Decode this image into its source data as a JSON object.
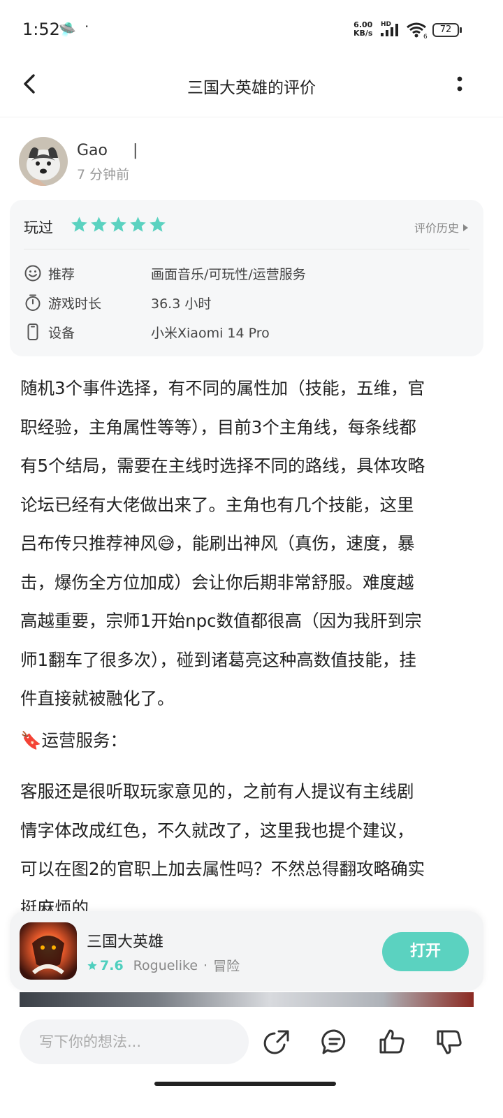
{
  "status_bar": {
    "time": "1:52",
    "net_speed_value": "6.00",
    "net_speed_unit": "KB/s",
    "hd_label": "HD",
    "wifi_label": "6",
    "battery": "72"
  },
  "header": {
    "title": "三国大英雄的评价"
  },
  "author": {
    "name": "Gao",
    "time": "7 分钟前"
  },
  "rating": {
    "played_label": "玩过",
    "stars": 5,
    "history_label": "评价历史",
    "star_color": "#5bd2c0",
    "rows": [
      {
        "label": "推荐",
        "value": "画面音乐/可玩性/运营服务"
      },
      {
        "label": "游戏时长",
        "value": "36.3 小时"
      },
      {
        "label": "设备",
        "value": "小米Xiaomi 14 Pro"
      }
    ]
  },
  "review": {
    "lines": [
      "随机3个事件选择，有不同的属性加（技能，五维，官",
      "职经验，主角属性等等），目前3个主角线，每条线都",
      "有5个结局，需要在主线时选择不同的路线，具体攻略",
      "论坛已经有大佬做出来了。主角也有几个技能，这里"
    ],
    "line5_a": "吕布传只推荐神风",
    "line5_b": "，能刷出神风（真伤，速度，暴",
    "lines_after": [
      "击，爆伤全方位加成）会让你后期非常舒服。难度越",
      "高越重要，宗师1开始npc数值都很高（因为我肝到宗",
      "师1翻车了很多次），碰到诸葛亮这种高数值技能，挂",
      "件直接就被融化了。"
    ],
    "section_title": "运营服务：",
    "lines_2": [
      "客服还是很听取玩家意见的，之前有人提议有主线剧",
      "情字体改成红色，不久就改了，这里我也提个建议，",
      "可以在图2的官职上加去属性吗？不然总得翻攻略确实",
      "挺麻烦的"
    ]
  },
  "game": {
    "name": "三国大英雄",
    "score": "7.6",
    "genre_1": "Roguelike",
    "separator": "·",
    "genre_2": "冒险",
    "open_label": "打开",
    "accent": "#5bd2c0"
  },
  "bottom_bar": {
    "placeholder": "写下你的想法..."
  }
}
